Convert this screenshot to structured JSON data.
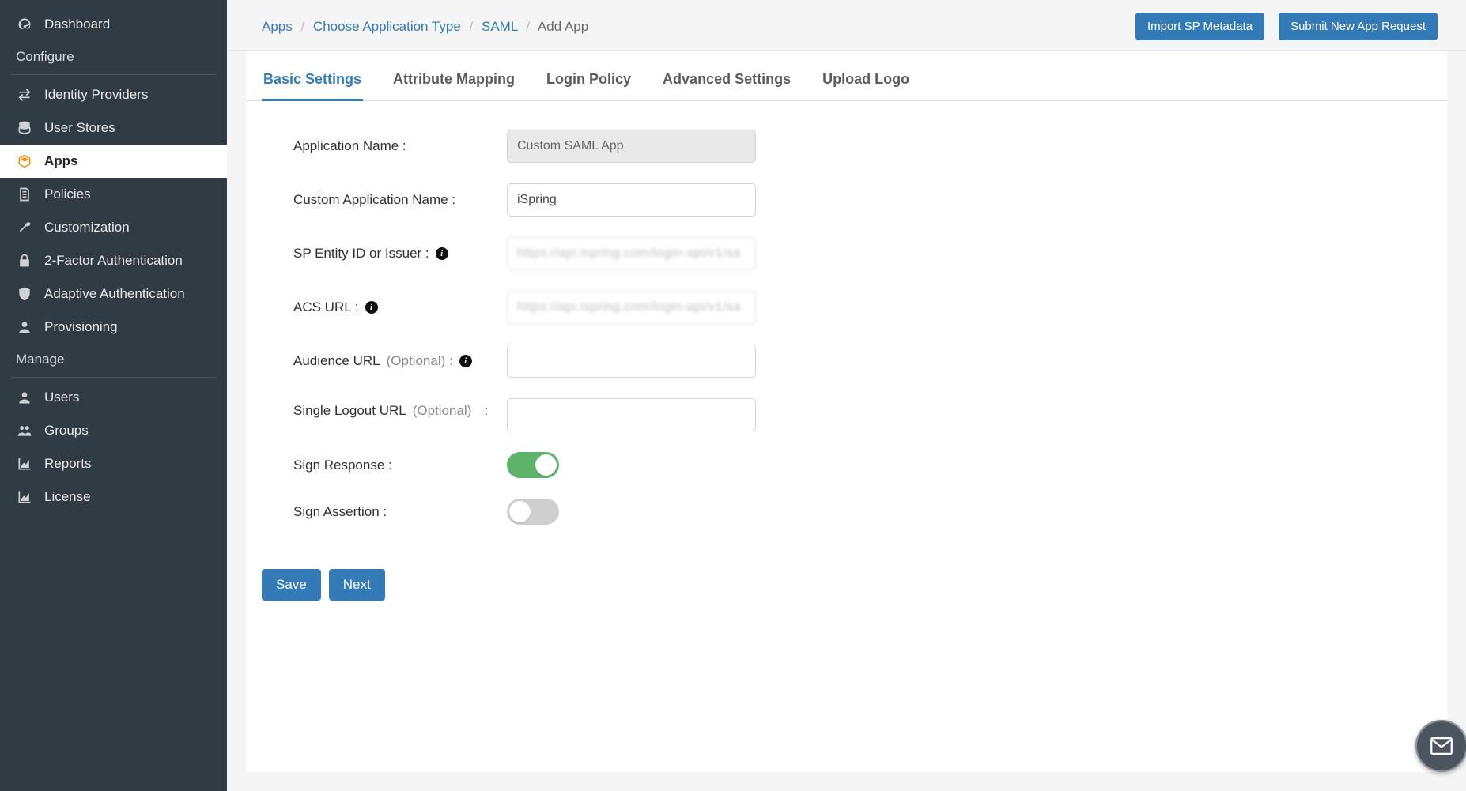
{
  "sidebar": {
    "items": [
      {
        "label": "Dashboard",
        "icon": "dashboard"
      },
      {
        "section": "Configure"
      },
      {
        "label": "Identity Providers",
        "icon": "swap"
      },
      {
        "label": "User Stores",
        "icon": "db"
      },
      {
        "label": "Apps",
        "icon": "cube",
        "active": true
      },
      {
        "label": "Policies",
        "icon": "doc"
      },
      {
        "label": "Customization",
        "icon": "wrench"
      },
      {
        "label": "2-Factor Authentication",
        "icon": "lock"
      },
      {
        "label": "Adaptive Authentication",
        "icon": "shield"
      },
      {
        "label": "Provisioning",
        "icon": "user"
      },
      {
        "section": "Manage"
      },
      {
        "label": "Users",
        "icon": "user"
      },
      {
        "label": "Groups",
        "icon": "users"
      },
      {
        "label": "Reports",
        "icon": "chart"
      },
      {
        "label": "License",
        "icon": "chart"
      }
    ]
  },
  "breadcrumb": {
    "items": [
      "Apps",
      "Choose Application Type",
      "SAML",
      "Add App"
    ]
  },
  "top_actions": {
    "import": "Import SP Metadata",
    "request": "Submit New App Request"
  },
  "tabs": [
    "Basic Settings",
    "Attribute Mapping",
    "Login Policy",
    "Advanced Settings",
    "Upload Logo"
  ],
  "active_tab": 0,
  "form": {
    "app_name_label": "Application Name :",
    "app_name_value": "Custom SAML App",
    "custom_name_label": "Custom Application Name :",
    "custom_name_value": "iSpring",
    "sp_entity_label": "SP Entity ID or Issuer :",
    "sp_entity_value": "https://api.ispring.com/login-api/v1/sa",
    "acs_url_label": "ACS URL :",
    "acs_url_value": "https://api.ispring.com/login-api/v1/sa",
    "audience_label": "Audience URL",
    "audience_opt": "(Optional) :",
    "audience_value": "",
    "slo_label": "Single Logout URL",
    "slo_opt": "(Optional)",
    "slo_colon": ":",
    "slo_value": "",
    "sign_response_label": "Sign Response :",
    "sign_response_on": true,
    "sign_assertion_label": "Sign Assertion :",
    "sign_assertion_on": false
  },
  "footer": {
    "save": "Save",
    "next": "Next"
  }
}
